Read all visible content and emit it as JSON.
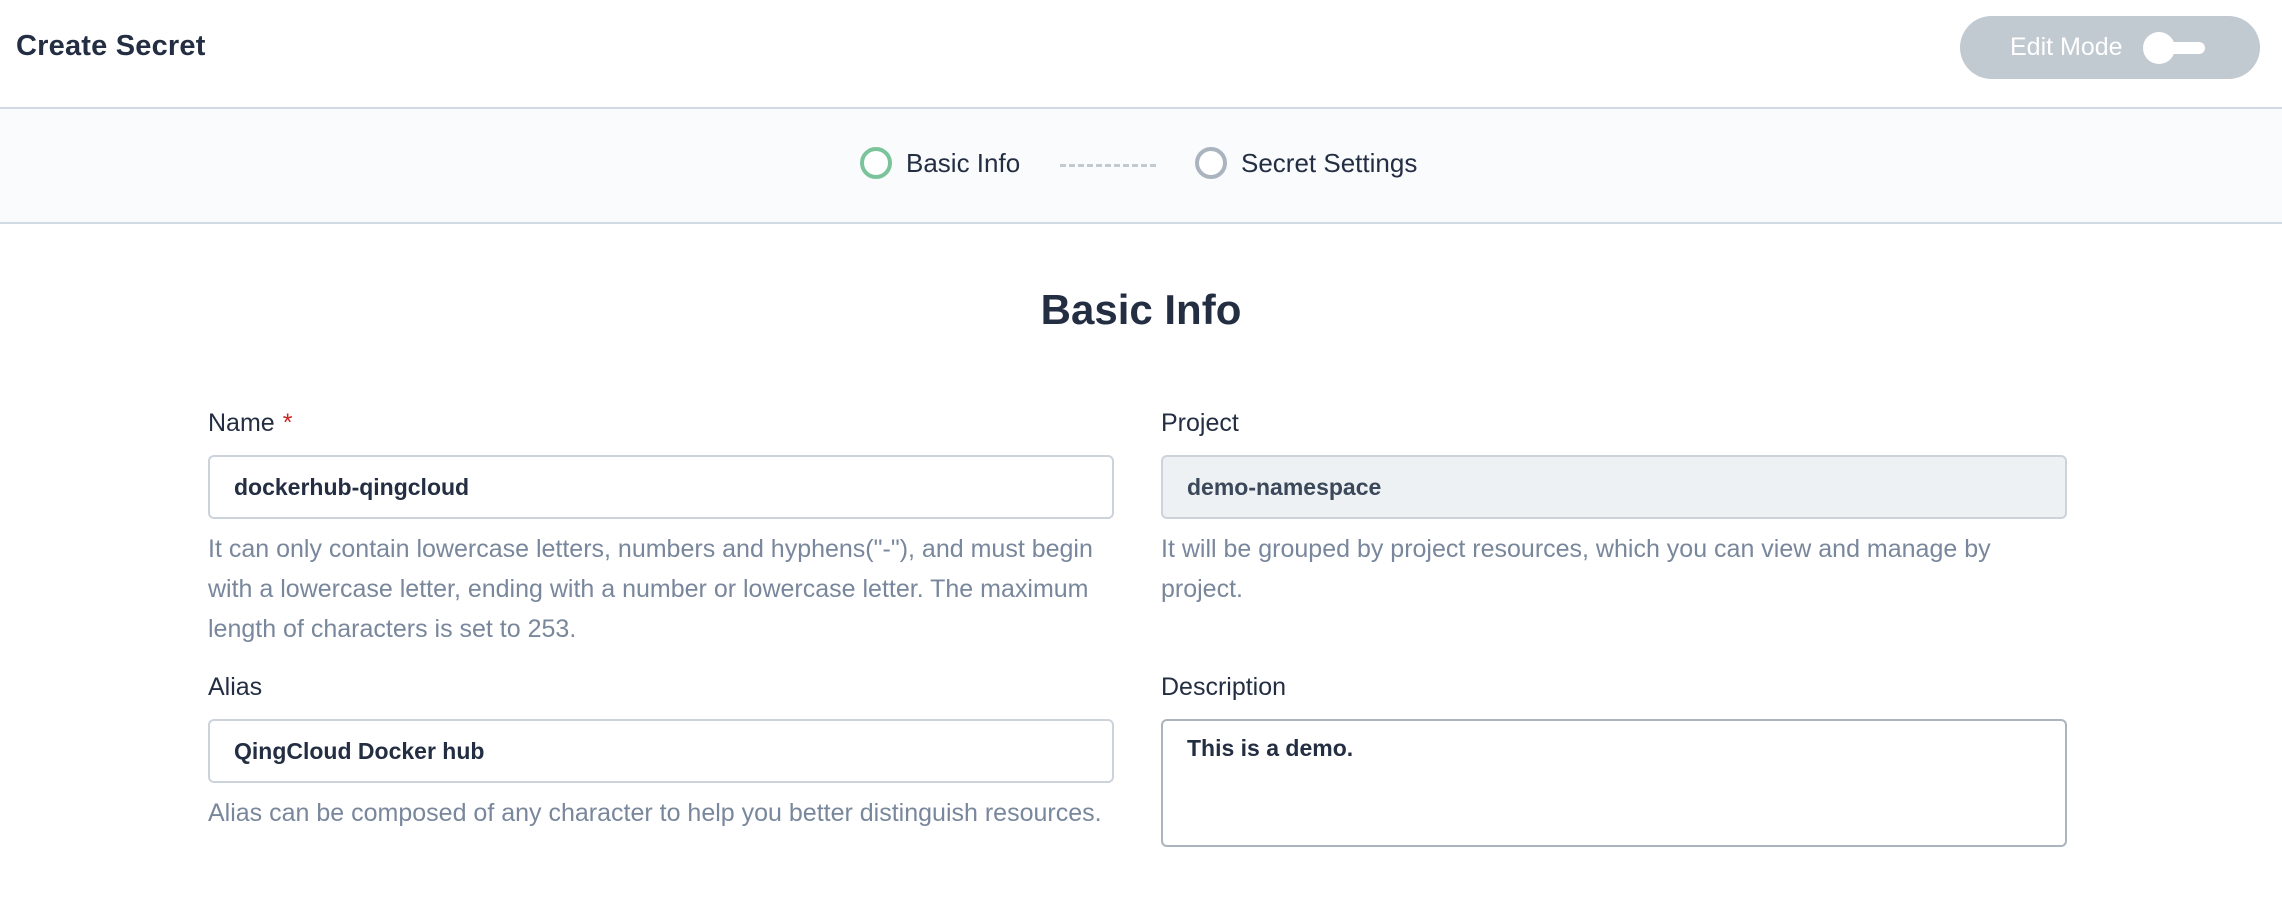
{
  "header": {
    "title": "Create Secret",
    "edit_mode_label": "Edit Mode"
  },
  "steps": [
    {
      "label": "Basic Info",
      "active": true
    },
    {
      "label": "Secret Settings",
      "active": false
    }
  ],
  "section": {
    "title": "Basic Info"
  },
  "form": {
    "name": {
      "label": "Name",
      "required_mark": "*",
      "value": "dockerhub-qingcloud",
      "help": "It can only contain lowercase letters, numbers and hyphens(\"-\"), and must begin with a lowercase letter, ending with a number or lowercase letter. The maximum length of characters is set to 253."
    },
    "project": {
      "label": "Project",
      "value": "demo-namespace",
      "help": "It will be grouped by project resources, which you can view and manage by project."
    },
    "alias": {
      "label": "Alias",
      "value": "QingCloud Docker hub",
      "help": "Alias can be composed of any character to help you better distinguish resources."
    },
    "description": {
      "label": "Description",
      "value": "This is a demo."
    }
  },
  "colors": {
    "active_step": "#7bc49b",
    "inactive_step": "#abb4be",
    "required": "#ca2621",
    "edit_mode_bg": "#c1c9d1"
  }
}
